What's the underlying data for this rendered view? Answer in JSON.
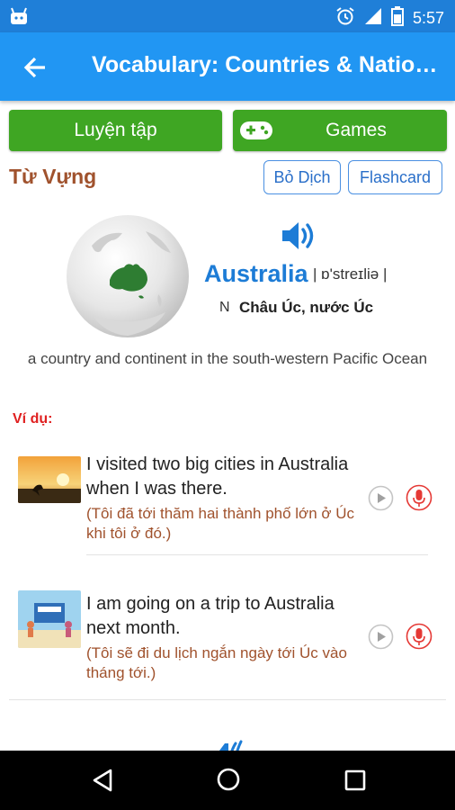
{
  "status_bar": {
    "time": "5:57",
    "icons": [
      "android-icon",
      "alarm-icon",
      "signal-icon",
      "battery-icon"
    ]
  },
  "app_bar": {
    "title": "Vocabulary: Countries & Nationalities"
  },
  "actions": {
    "practice_label": "Luyện tập",
    "games_label": "Games"
  },
  "section": {
    "title": "Từ Vựng",
    "translate_toggle": "Bỏ Dịch",
    "flashcard": "Flashcard"
  },
  "word_card": {
    "word": "Australia",
    "phonetic": "| ɒ'streɪliə |",
    "pos": "N",
    "meaning": "Châu Úc, nước Úc",
    "definition": "a country and continent in the south-western Pacific Ocean"
  },
  "examples": {
    "heading": "Ví dụ:",
    "items": [
      {
        "en": "I visited two big cities in Australia when I was there.",
        "vi": "(Tôi đã tới thăm hai thành phố lớn ở Úc khi tôi ở đó.)"
      },
      {
        "en": "I am going on a trip to Australia next month.",
        "vi": "(Tôi sẽ đi du lịch ngắn ngày tới Úc vào tháng tới.)"
      }
    ]
  },
  "colors": {
    "status_bar": "#1f7fd8",
    "app_bar": "#2196f3",
    "green_button": "#3fa623",
    "section_title": "#a0522d",
    "word": "#1d7cd6",
    "example_label": "#e02020",
    "mic": "#e53935"
  }
}
